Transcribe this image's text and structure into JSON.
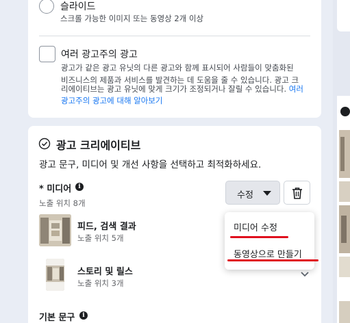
{
  "placement_options": {
    "slide": {
      "title": "슬라이드",
      "desc": "스크롤 가능한 이미지 또는 동영상 2개 이상"
    },
    "multi_advertiser": {
      "title": "여러 광고주의 광고",
      "desc_line1": "광고가 같은 광고 유닛의 다른 광고와 함께 표시되어 사람들이 맞춤화된",
      "desc_line2": "비즈니스의 제품과 서비스를 발견하는 데 도움을 줄 수 있습니다. 광고 크",
      "desc_line3_text": "리에이티브는 광고 유닛에 맞게 크기가 조정되거나 잘릴 수 있습니다.",
      "desc_line3_link": "여러",
      "desc_line4_link": "광고주의 광고에 대해 알아보기"
    }
  },
  "creative": {
    "title": "광고 크리에이티브",
    "desc": "광고 문구, 미디어 및 개선 사항을 선택하고 최적화하세요.",
    "media": {
      "label": "* 미디어",
      "info_glyph": "i",
      "placements": "노출 위치 8개",
      "edit_button": "수정",
      "rows": [
        {
          "title": "피드, 검색 결과",
          "sub": "노출 위치 5개"
        },
        {
          "title": "스토리 및 릴스",
          "sub": "노출 위치 3개"
        }
      ]
    },
    "dropdown": {
      "items": [
        "미디어 수정",
        "동영상으로 만들기"
      ]
    },
    "primary_text": {
      "label": "기본 문구",
      "info_glyph": "i"
    }
  },
  "colors": {
    "accent_link": "#1877f2",
    "annotation_red": "#e0101e",
    "background": "#e9edf5"
  }
}
